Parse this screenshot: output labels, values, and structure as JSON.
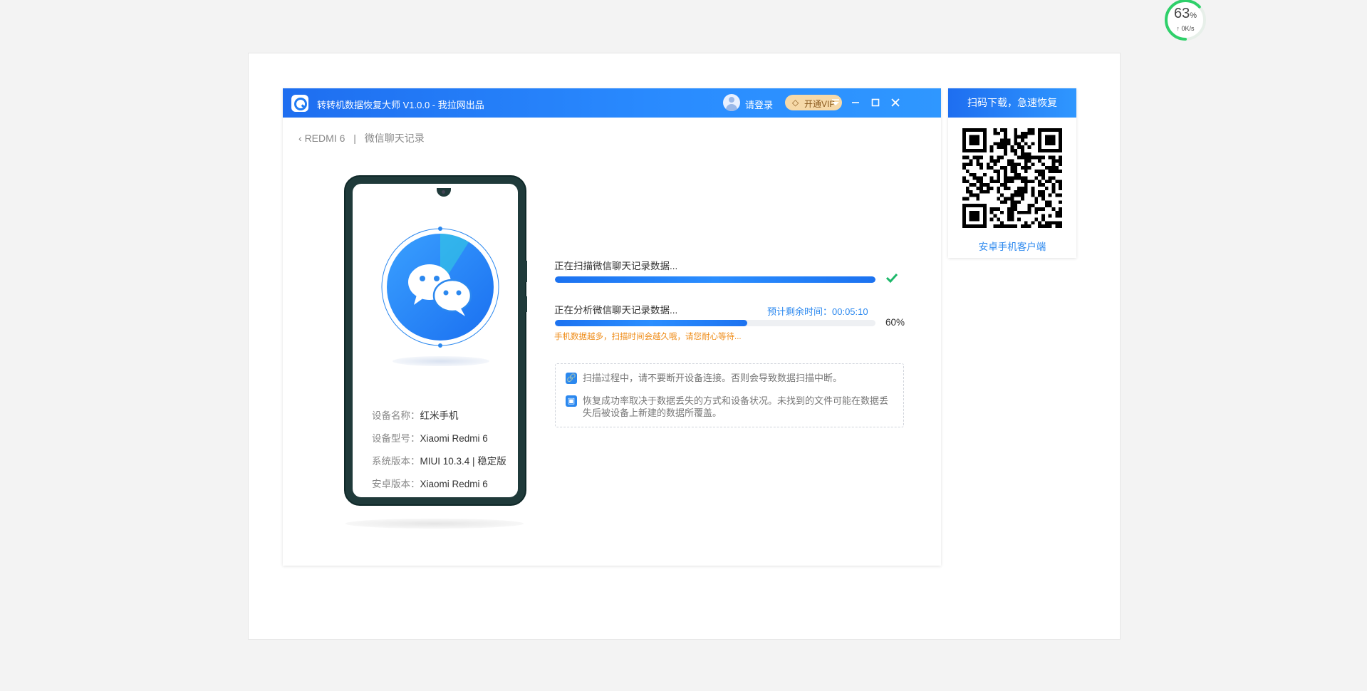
{
  "speed_widget": {
    "percent": "63",
    "unit": "%",
    "rate": "0K/s",
    "level": 0.63,
    "arrow": "up-arrow-icon"
  },
  "window": {
    "title": "转转机数据恢复大师 V1.0.0 - 我拉网出品",
    "login_label": "请登录",
    "vip_label": "开通VIP",
    "controls": [
      "menu-icon",
      "minimize-icon",
      "maximize-icon",
      "close-icon"
    ]
  },
  "breadcrumb": {
    "device": "REDMI 6",
    "separator": "|",
    "page": "微信聊天记录"
  },
  "device_info": [
    {
      "key": "设备名称：",
      "value": "红米手机"
    },
    {
      "key": "设备型号：",
      "value": "Xiaomi Redmi 6"
    },
    {
      "key": "系统版本：",
      "value": "MIUI 10.3.4 | 稳定版"
    },
    {
      "key": "安卓版本：",
      "value": "Xiaomi Redmi 6"
    }
  ],
  "progress": {
    "scan_title": "正在扫描微信聊天记录数据...",
    "scan_fraction": 1.0,
    "analyze_title": "正在分析微信聊天记录数据...",
    "eta": "预计剩余时间：00:05:10",
    "analyze_fraction": 0.6,
    "analyze_percent": "60%",
    "warning": "手机数据越多，扫描时间会越久哦，请您耐心等待..."
  },
  "notes": [
    {
      "icon": "link-icon",
      "text": "扫描过程中，请不要断开设备连接。否则会导致数据扫描中断。"
    },
    {
      "icon": "box-icon",
      "text": "恢复成功率取决于数据丢失的方式和设备状况。未找到的文件可能在数据丢失后被设备上新建的数据所覆盖。"
    }
  ],
  "qr_panel": {
    "header": "扫码下载，急速恢复",
    "label": "安卓手机客户端"
  },
  "colors": {
    "accent": "#1f7cf4",
    "warning": "#ef8c18",
    "success": "#1db86a",
    "vip": "#f6d9a8"
  }
}
